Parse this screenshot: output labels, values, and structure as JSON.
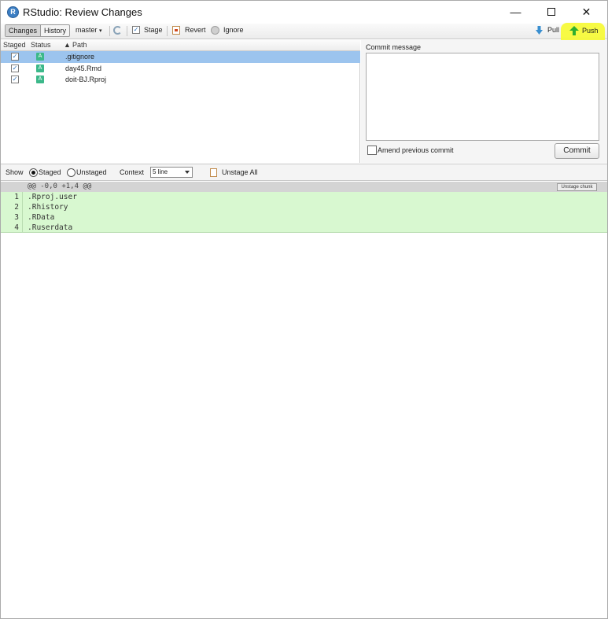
{
  "window": {
    "title": "RStudio: Review Changes",
    "app_icon_letter": "R"
  },
  "toolbar": {
    "tab_changes": "Changes",
    "tab_history": "History",
    "branch": "master",
    "stage": "Stage",
    "revert": "Revert",
    "ignore": "Ignore",
    "pull": "Pull",
    "push": "Push"
  },
  "file_list": {
    "headers": {
      "staged": "Staged",
      "status": "Status",
      "path": "Path"
    },
    "rows": [
      {
        "staged": true,
        "status": "A",
        "path": ".gitignore",
        "selected": true
      },
      {
        "staged": true,
        "status": "A",
        "path": "day45.Rmd",
        "selected": false
      },
      {
        "staged": true,
        "status": "A",
        "path": "doit-BJ.Rproj",
        "selected": false
      }
    ]
  },
  "commit": {
    "message_label": "Commit message",
    "message_value": "",
    "amend_label": "Amend previous commit",
    "commit_button": "Commit"
  },
  "diff_toolbar": {
    "show_label": "Show",
    "staged_label": "Staged",
    "unstaged_label": "Unstaged",
    "context_label": "Context",
    "context_value": "5 line",
    "unstage_all": "Unstage All"
  },
  "diff": {
    "chunk_header": "@@ -0,0 +1,4 @@",
    "unstage_chunk": "Unstage chunk",
    "lines": [
      {
        "num": "1",
        "text": ".Rproj.user"
      },
      {
        "num": "2",
        "text": ".Rhistory"
      },
      {
        "num": "3",
        "text": ".RData"
      },
      {
        "num": "4",
        "text": ".Ruserdata"
      }
    ]
  },
  "colors": {
    "selected_row": "#9cc4ee",
    "added_badge": "#3cb88a",
    "diff_added_bg": "#d8f8d0",
    "push_highlight": "#f7fa3a"
  }
}
